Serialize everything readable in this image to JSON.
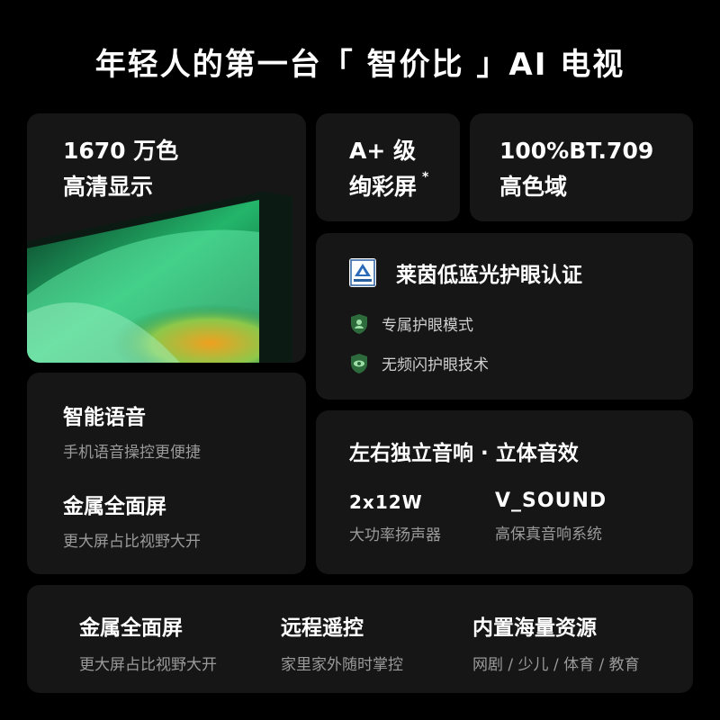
{
  "title": "年轻人的第一台「 智价比 」AI 电视",
  "display_card": {
    "line1": "1670 万色",
    "line2": "高清显示"
  },
  "grade_card": {
    "line1": "A+ 级",
    "line2": "绚彩屏",
    "footnote": "*"
  },
  "gamut_card": {
    "line1": "100%BT.709",
    "line2": "高色域"
  },
  "eye_card": {
    "heading": "莱茵低蓝光护眼认证",
    "features": [
      "专属护眼模式",
      "无频闪护眼技术"
    ]
  },
  "voice_card": {
    "heading1": "智能语音",
    "sub1": "手机语音操控更便捷",
    "heading2": "金属全面屏",
    "sub2": "更大屏占比视野大开"
  },
  "audio_card": {
    "heading": "左右独立音响 · 立体音效",
    "spec1_value": "2x12W",
    "spec1_label": "大功率扬声器",
    "spec2_value": "V_SOUND",
    "spec2_label": "高保真音响系统"
  },
  "bottom_card": {
    "items": [
      {
        "heading": "金属全面屏",
        "sub": "更大屏占比视野大开"
      },
      {
        "heading": "远程遥控",
        "sub": "家里家外随时掌控"
      },
      {
        "heading": "内置海量资源",
        "sub": "网剧 / 少儿 / 体育 / 教育"
      }
    ]
  },
  "colors": {
    "background": "#000000",
    "card": "#161616",
    "muted_text": "#9a9a9a",
    "screen_accent": "#3ecf7a"
  }
}
